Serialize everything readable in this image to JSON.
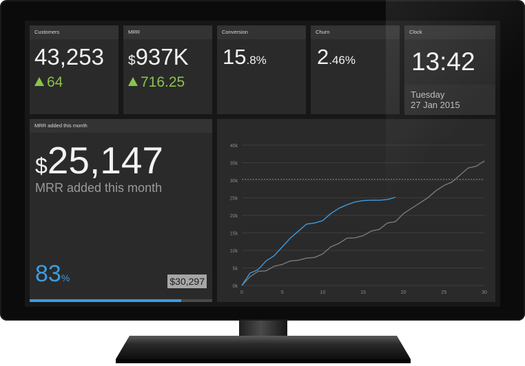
{
  "tiles": {
    "customers": {
      "title": "Customers",
      "value": "43,253",
      "delta": "64"
    },
    "mrr": {
      "title": "MRR",
      "currency": "$",
      "value": "937K",
      "delta": "716.25"
    },
    "conversion": {
      "title": "Conversion",
      "value": "15",
      "suffix": ".8%"
    },
    "churn": {
      "title": "Churn",
      "value": "2",
      "suffix": ".46%"
    },
    "clock": {
      "title": "Clock",
      "time": "13:42",
      "day": "Tuesday",
      "date": "27 Jan 2015"
    },
    "mrr_added": {
      "title": "MRR added this month",
      "currency": "$",
      "value": "25,147",
      "subtitle": "MRR added this month",
      "percent": "83",
      "percent_sign": "%",
      "target": "$30,297",
      "progress": 0.83
    }
  },
  "colors": {
    "accent": "#3d9be0",
    "positive": "#8bc34a",
    "series_prior": "#7a7a7a",
    "tile_bg": "#2a2a2a"
  },
  "chart_data": {
    "type": "line",
    "xlim": [
      0,
      30
    ],
    "ylim": [
      0,
      40000
    ],
    "x_ticks": [
      0,
      5,
      10,
      15,
      20,
      25,
      30
    ],
    "y_ticks": [
      "0k",
      "5k",
      "10k",
      "15k",
      "20k",
      "25k",
      "30k",
      "35k",
      "40k"
    ],
    "grid": true,
    "reference_line": 30297,
    "series": [
      {
        "color": "#3d9be0",
        "x": [
          0,
          1,
          2,
          3,
          4,
          5,
          6,
          7,
          8,
          9,
          10,
          11,
          12,
          13,
          14,
          15,
          16,
          17,
          18,
          19
        ],
        "values": [
          0,
          3500,
          4500,
          7000,
          8500,
          11000,
          13500,
          15500,
          17500,
          17800,
          18500,
          20500,
          22000,
          23000,
          23800,
          24200,
          24300,
          24300,
          24500,
          25147
        ]
      },
      {
        "color": "#7a7a7a",
        "x": [
          0,
          1,
          2,
          3,
          4,
          5,
          6,
          7,
          8,
          9,
          10,
          11,
          12,
          13,
          14,
          15,
          16,
          17,
          18,
          19,
          20,
          21,
          22,
          23,
          24,
          25,
          26,
          27,
          28,
          29,
          30
        ],
        "values": [
          0,
          2500,
          4000,
          4200,
          5500,
          6000,
          7000,
          7200,
          7800,
          8000,
          9000,
          11000,
          12000,
          13500,
          13600,
          14200,
          15500,
          16000,
          17800,
          18200,
          20500,
          22000,
          23500,
          25000,
          27000,
          28500,
          29500,
          31500,
          33500,
          34000,
          35500
        ]
      }
    ]
  }
}
